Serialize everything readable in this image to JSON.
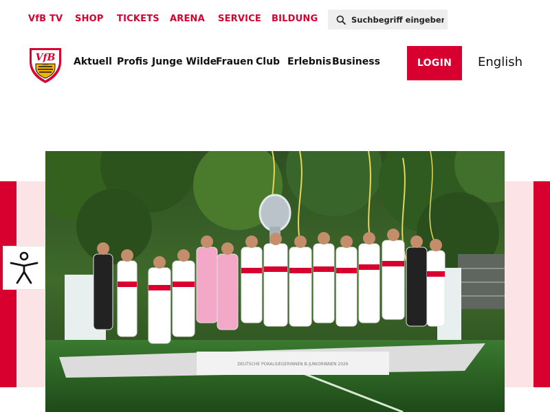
{
  "topnav": {
    "items": [
      "VfB TV",
      "SHOP",
      "TICKETS",
      "ARENA",
      "SERVICE",
      "BILDUNG"
    ],
    "search_placeholder": "Suchbegriff eingeben..."
  },
  "mainnav": {
    "items": [
      "Aktuell",
      "Profis",
      "Junge Wilde",
      "Frauen",
      "Club",
      "Erlebnis",
      "Business"
    ]
  },
  "header": {
    "login_label": "LOGIN",
    "language_label": "English"
  },
  "logo": {
    "text": "VfB",
    "year": "1893"
  },
  "hero": {
    "podium_banner": "DEUTSCHE POKALSIEGERINNEN B-JUNIORINNEN 2026"
  },
  "colors": {
    "brand_red": "#d7002f",
    "band_pink": "#fbe3e6",
    "search_bg": "#eeeeee",
    "grass": "#2f6a2a"
  }
}
